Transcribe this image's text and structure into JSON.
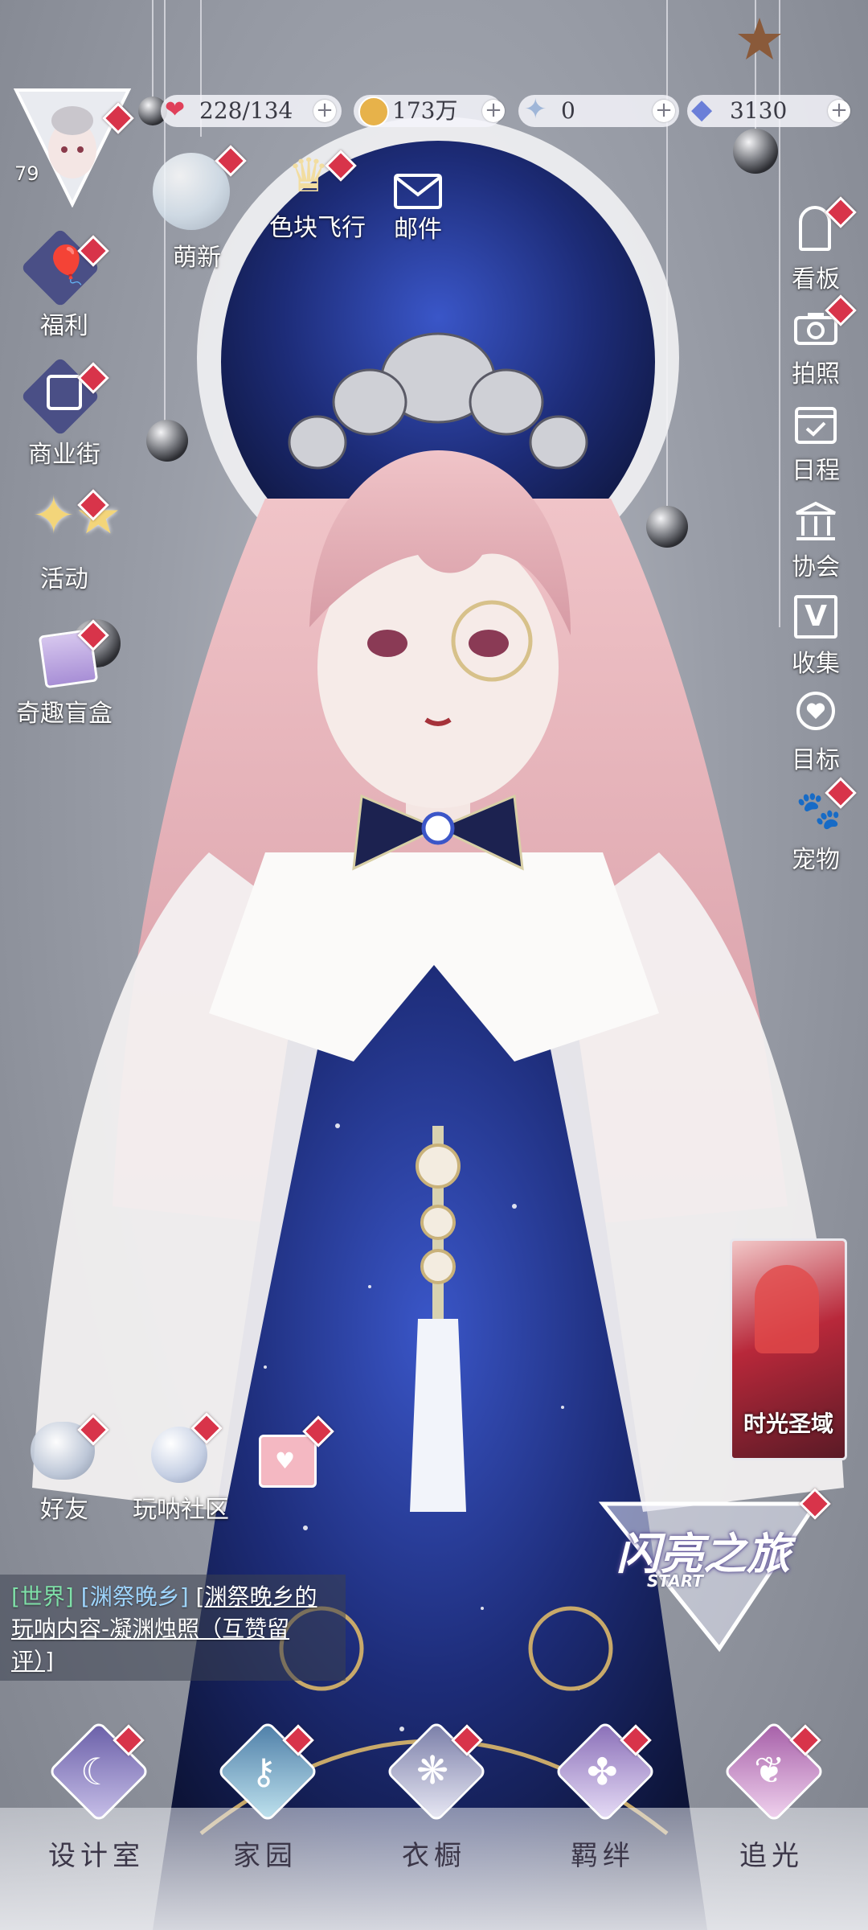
{
  "profile": {
    "level": "79"
  },
  "currency": {
    "stamina": "228/134",
    "gold": "173万",
    "crystal": "0",
    "diamond": "3130"
  },
  "top_menu": {
    "newbie": "萌新",
    "color_flight": "色块飞行",
    "mail": "邮件"
  },
  "left_menu": [
    {
      "label": "福利"
    },
    {
      "label": "商业街"
    },
    {
      "label": "活动"
    },
    {
      "label": "奇趣盲盒"
    }
  ],
  "right_menu": [
    {
      "label": "看板"
    },
    {
      "label": "拍照"
    },
    {
      "label": "日程"
    },
    {
      "label": "协会"
    },
    {
      "label": "收集"
    },
    {
      "label": "目标"
    },
    {
      "label": "宠物"
    }
  ],
  "social": {
    "friends": "好友",
    "community": "玩呐社区"
  },
  "event_banner": {
    "title": "时光圣域"
  },
  "start_button": {
    "title": "闪亮之旅",
    "subtitle": "START"
  },
  "chat": {
    "channel": "[世界]",
    "sender": "[渊祭晚乡]",
    "message_link": "[渊祭晚乡的",
    "message_rest": "玩呐内容-凝渊烛照（互赞留",
    "message_end": "评）]"
  },
  "bottom_nav": [
    {
      "label": "设计室"
    },
    {
      "label": "家园"
    },
    {
      "label": "衣橱"
    },
    {
      "label": "羁绊"
    },
    {
      "label": "追光"
    }
  ],
  "colors": {
    "badge": "#d8344a",
    "chat_channel": "#7fe0a8",
    "chat_sender": "#9fd6ff",
    "dress": "#1f2f7a",
    "hair": "#e8b8bf"
  }
}
